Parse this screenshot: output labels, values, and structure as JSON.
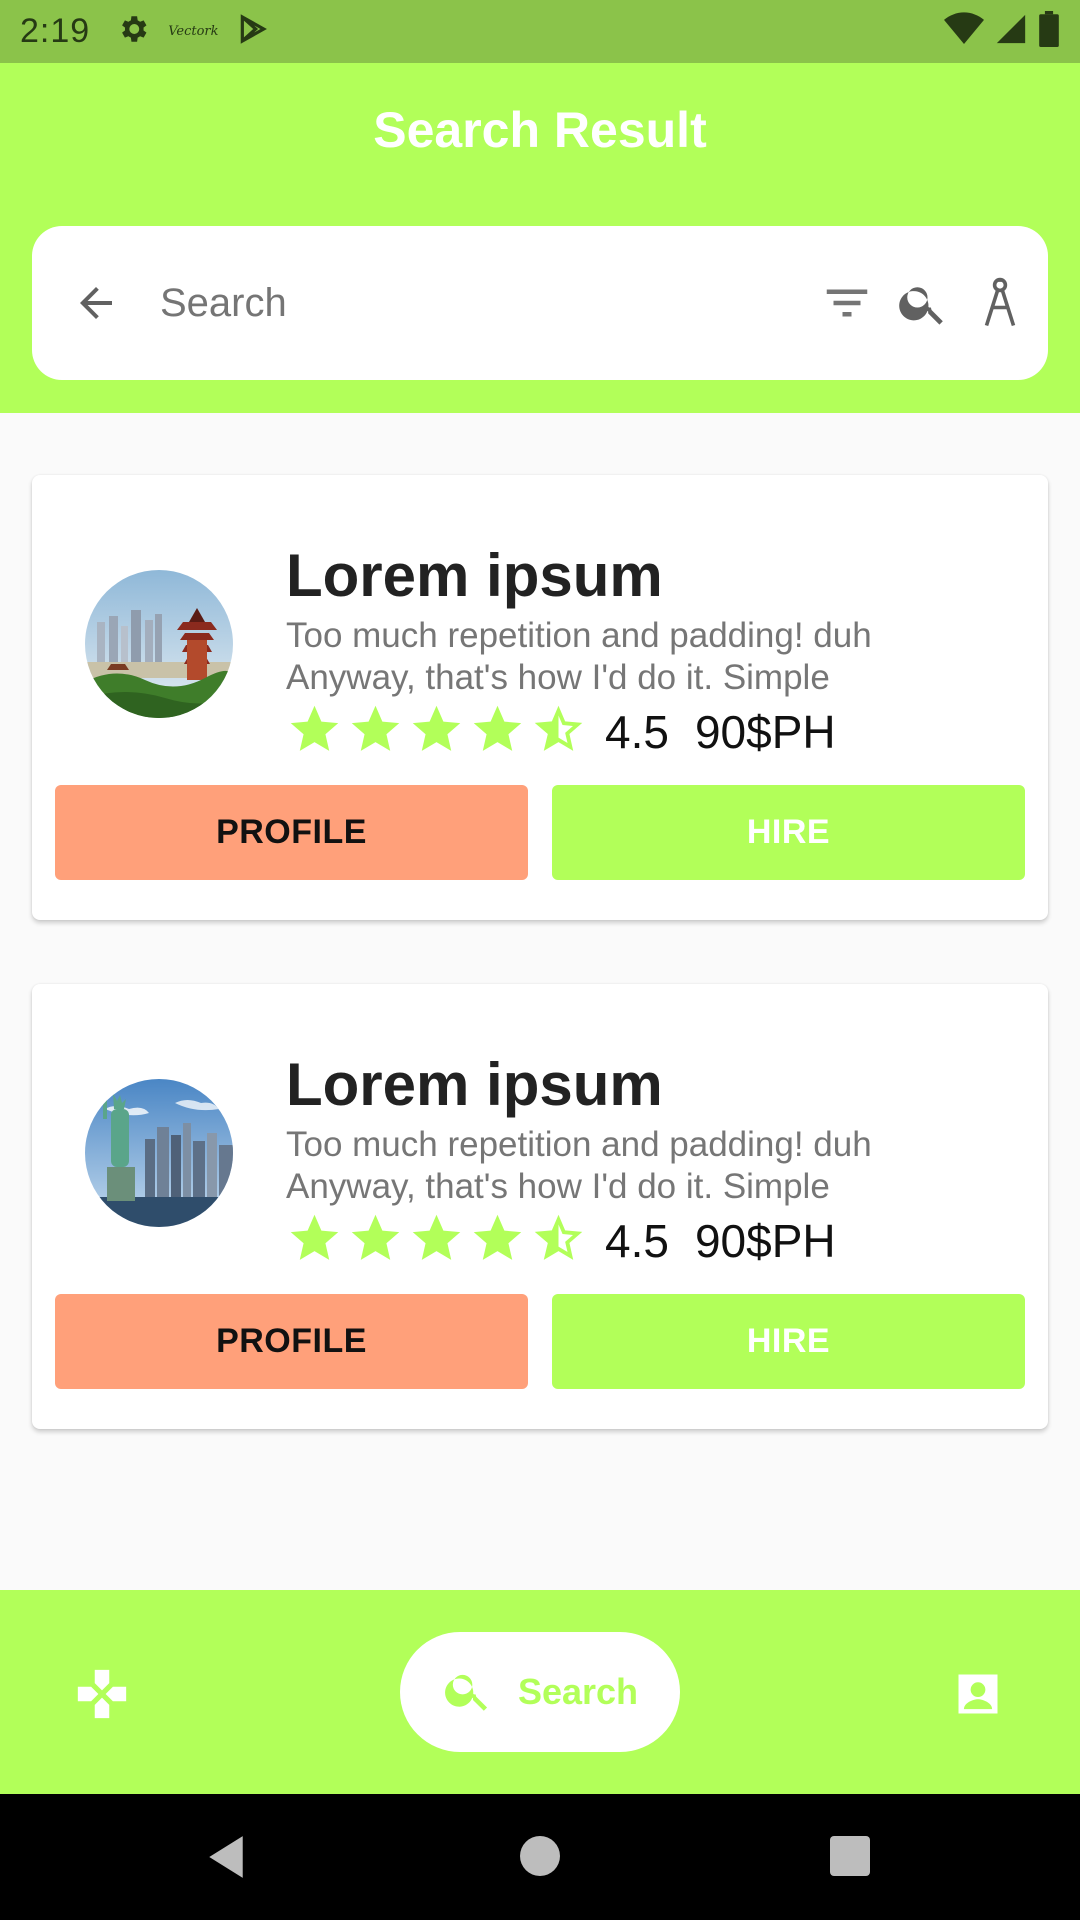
{
  "status_bar": {
    "time": "2:19",
    "brand_text": "Vectork",
    "icons": [
      "gear-icon",
      "play-store-icon",
      "wifi-icon",
      "cell-signal-icon",
      "battery-icon"
    ]
  },
  "app_bar": {
    "title": "Search Result"
  },
  "search": {
    "placeholder": "Search",
    "icons": [
      "back-arrow-icon",
      "filter-icon",
      "search-icon",
      "compass-icon"
    ]
  },
  "results": [
    {
      "title": "Lorem ipsum",
      "description_line1": "Too much repetition and padding! duh",
      "description_line2": "Anyway, that's how I'd do it. Simple",
      "rating": 4.5,
      "rating_label": "4.5",
      "rate": "90$PH",
      "profile_label": "PROFILE",
      "hire_label": "HIRE",
      "avatar": "pagoda-city-image"
    },
    {
      "title": "Lorem ipsum",
      "description_line1": "Too much repetition and padding! duh",
      "description_line2": "Anyway, that's how I'd do it. Simple",
      "rating": 4.5,
      "rating_label": "4.5",
      "rate": "90$PH",
      "profile_label": "PROFILE",
      "hire_label": "HIRE",
      "avatar": "statue-of-liberty-image"
    }
  ],
  "bottom_nav": {
    "left_icon": "gamepad-icon",
    "active_label": "Search",
    "active_icon": "search-icon",
    "right_icon": "contact-icon"
  },
  "colors": {
    "status_bar": "#8bc34a",
    "accent": "#b2ff59",
    "profile_button": "#ffa07a",
    "star": "#b2ff59"
  }
}
